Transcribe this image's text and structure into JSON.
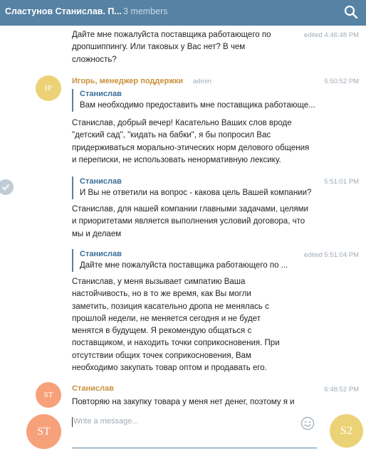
{
  "header": {
    "title": "Сластунов Станислав. П...",
    "members": "3 members",
    "search_icon": "search-icon"
  },
  "messages": [
    {
      "text": "Дайте мне пожалуйста поставщика работающего по\nдропшиппингу. Или таковых у Вас нет? В чем\nсложность?",
      "meta": "edited 4:46:48 PM"
    },
    {
      "avatar": "IP",
      "sender": "Игорь, менеджер поддержки",
      "role": "admin",
      "time": "5:50:52 PM",
      "reply_name": "Станислав",
      "reply_text": "Вам необходимо предоставить мне поставщика работающе...",
      "text": "Станислав, добрый вечер! Касательно Ваших слов вроде\n\"детский сад\", \"кидать на бабки\", я бы попросил Вас\nпридерживаться морально-этических норм делового общения\nи переписки, не использовать ненормативную лексику."
    },
    {
      "time": "5:51:01 PM",
      "reply_name": "Станислав",
      "reply_text": "И Вы не ответили на вопрос - какова цель Вашей компании?",
      "text": "Станислав, для нашей компании главными задачами, целями\nи приоритетами является выполнения условий договора, что\nмы и делаем"
    },
    {
      "meta": "edited 5:51:04 PM",
      "reply_name": "Станислав",
      "reply_text": "Дайте мне пожалуйста поставщика работающего по ...",
      "text": "Станислав, у меня вызывает симпатию Ваша\nнастойчивость, но в то же время, как Вы могли\nзаметить, позиция касательно дропа не менялась с\nпрошлой недели, не меняется сегодня и не будет\nменятся в будущем. Я рекомендую общаться с\nпоставщиком, и находить точки соприкосновения.  При\nотсутствии общих точек соприкосновения, Вам\nнеобходимо закупать товар оптом и продавать его."
    },
    {
      "avatar": "ST",
      "sender": "Станислав",
      "time": "6:48:52 PM",
      "text": "Повторяю на закупку товара у меня нет денег, поэтому я и"
    }
  ],
  "composer": {
    "my_avatar": "ST",
    "placeholder": "Write a message...",
    "emoji_icon": "emoji-icon",
    "peer_avatar": "S2"
  },
  "colors": {
    "header_bg": "#5682a3",
    "accent": "#3a6d99",
    "avatar_ip": "#ecd276",
    "avatar_st": "#f7a17b",
    "sender_orange": "#c8913a"
  }
}
